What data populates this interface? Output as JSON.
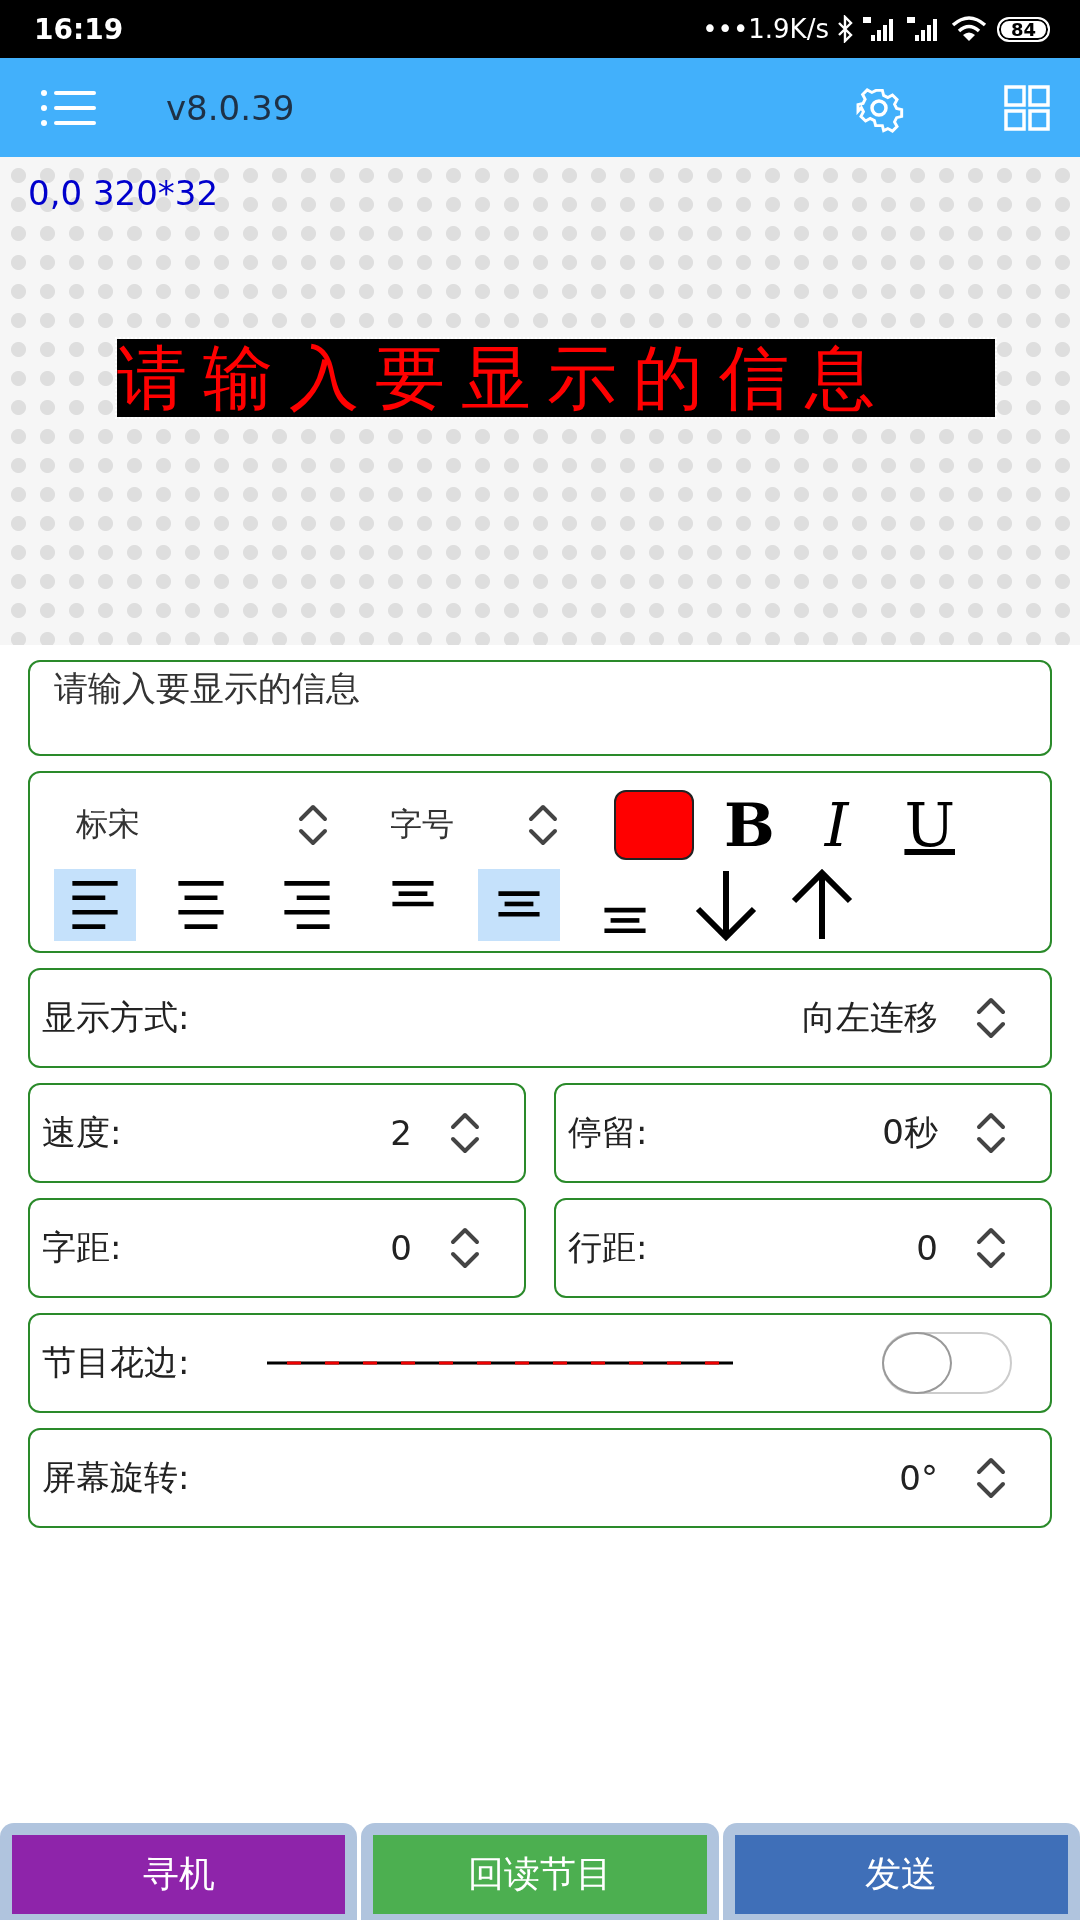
{
  "status_bar": {
    "time": "16:19",
    "net_speed": "•••1.9K/s",
    "battery": "84"
  },
  "app_bar": {
    "version": "v8.0.39"
  },
  "preview": {
    "coords": "0,0 320*32",
    "led_text": "请输入要显示的信息"
  },
  "message_input": {
    "value": "请输入要显示的信息"
  },
  "format": {
    "font": "标宋",
    "size_label": "字号",
    "color": "#ff0000",
    "bold": "B",
    "italic": "I",
    "underline": "U",
    "align": [
      {
        "kind": "left",
        "selected": true
      },
      {
        "kind": "center",
        "selected": false
      },
      {
        "kind": "right",
        "selected": false
      },
      {
        "kind": "top",
        "selected": false
      },
      {
        "kind": "middle",
        "selected": true
      },
      {
        "kind": "bottom",
        "selected": false
      }
    ]
  },
  "settings": [
    {
      "kind": "select",
      "label": "显示方式:",
      "value": "向左连移"
    },
    {
      "kind": "pair",
      "items": [
        {
          "label": "速度:",
          "value": "2"
        },
        {
          "label": "停留:",
          "value": "0秒"
        }
      ]
    },
    {
      "kind": "pair",
      "items": [
        {
          "label": "字距:",
          "value": "0"
        },
        {
          "label": "行距:",
          "value": "0"
        }
      ]
    },
    {
      "kind": "toggle",
      "label": "节目花边:",
      "on": false
    },
    {
      "kind": "select",
      "label": "屏幕旋转:",
      "value": "0°"
    }
  ],
  "buttons": [
    {
      "label": "寻机",
      "color": "#8e24aa"
    },
    {
      "label": "回读节目",
      "color": "#4caf50"
    },
    {
      "label": "发送",
      "color": "#3f6fb8"
    }
  ]
}
